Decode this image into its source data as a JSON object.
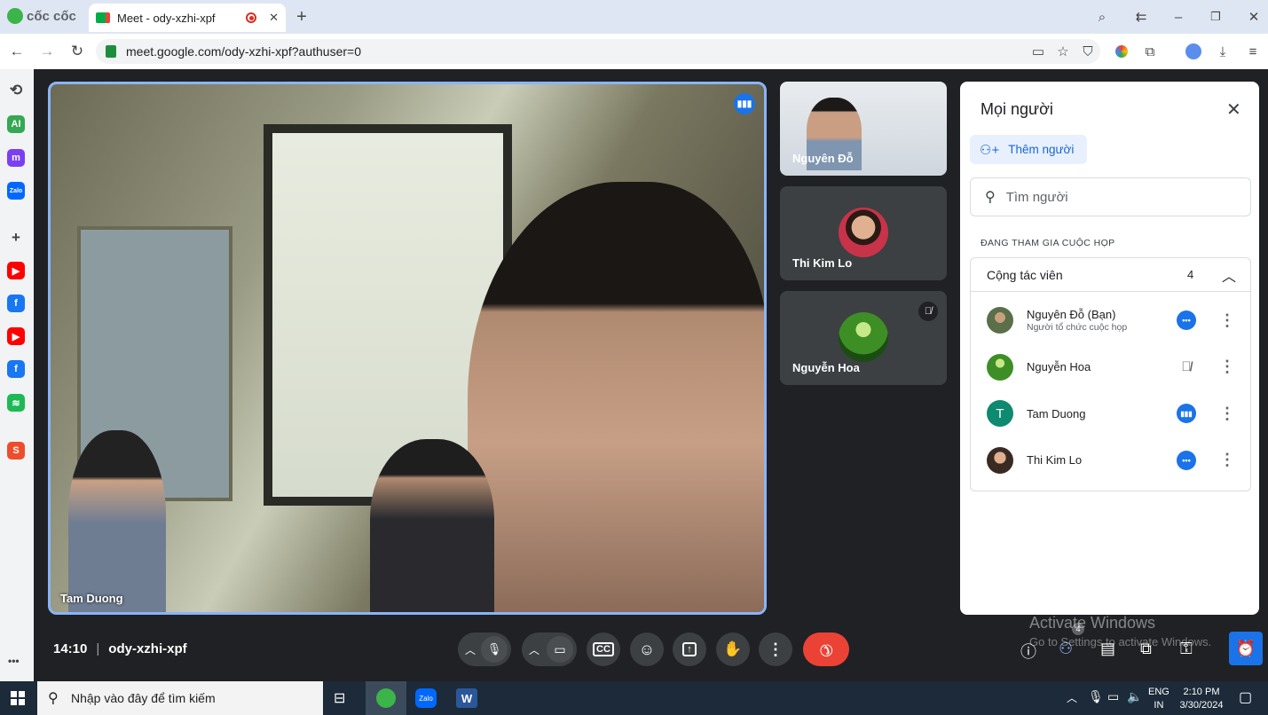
{
  "browser": {
    "brand": "cốc cốc",
    "tab_title": "Meet - ody-xzhi-xpf",
    "new_tab": "+",
    "url": "meet.google.com/ody-xzhi-xpf?authuser=0",
    "window_controls": {
      "minimize": "–",
      "restore": "❐",
      "close": "✕"
    }
  },
  "sidebar": {
    "items": [
      {
        "label": "⟲",
        "icon": "history-icon",
        "color": "#444444"
      },
      {
        "label": "AI",
        "icon": "ai-icon",
        "color": "#34a853"
      },
      {
        "label": "m",
        "icon": "messenger-icon",
        "color": "#7b3ff2"
      },
      {
        "label": "Zalo",
        "icon": "zalo-icon",
        "color": "#0068ff"
      },
      {
        "label": "+",
        "icon": "add-icon",
        "color": "#444444"
      },
      {
        "label": "▶",
        "icon": "youtube-icon",
        "color": "#ff0000"
      },
      {
        "label": "f",
        "icon": "facebook-icon",
        "color": "#1877f2"
      },
      {
        "label": "▶",
        "icon": "youtube-icon",
        "color": "#ff0000"
      },
      {
        "label": "f",
        "icon": "facebook-icon",
        "color": "#1877f2"
      },
      {
        "label": "≋",
        "icon": "spotify-icon",
        "color": "#1db954"
      },
      {
        "label": "S",
        "icon": "shopee-icon",
        "color": "#ee4d2d"
      }
    ],
    "more": "•••"
  },
  "meet": {
    "main_speaker": "Tam Duong",
    "tiles": [
      {
        "name": "Nguyên Đỗ",
        "muted": false
      },
      {
        "name": "Thi Kim Lo",
        "muted": false
      },
      {
        "name": "Nguyễn Hoa",
        "muted": true
      }
    ],
    "time": "14:10",
    "separator": "|",
    "meeting_code": "ody-xzhi-xpf",
    "people_badge": "4"
  },
  "people_panel": {
    "title": "Mọi người",
    "add_people": "Thêm người",
    "search_placeholder": "Tìm người",
    "section_label": "ĐANG THAM GIA CUỘC HỌP",
    "group_label": "Cộng tác viên",
    "group_count": "4",
    "participants": [
      {
        "name": "Nguyên Đỗ (Bạn)",
        "subtitle": "Người tổ chức cuộc họp",
        "status": "more"
      },
      {
        "name": "Nguyễn Hoa",
        "subtitle": "",
        "status": "muted"
      },
      {
        "name": "Tam Duong",
        "subtitle": "",
        "status": "speaking",
        "initial": "T"
      },
      {
        "name": "Thi Kim Lo",
        "subtitle": "",
        "status": "more"
      }
    ]
  },
  "watermark": {
    "line1": "Activate Windows",
    "line2": "Go to Settings to activate Windows."
  },
  "taskbar": {
    "search_placeholder": "Nhập vào đây để tìm kiếm",
    "lang_top": "ENG",
    "lang_bottom": "IN",
    "time": "2:10 PM",
    "date": "3/30/2024"
  }
}
